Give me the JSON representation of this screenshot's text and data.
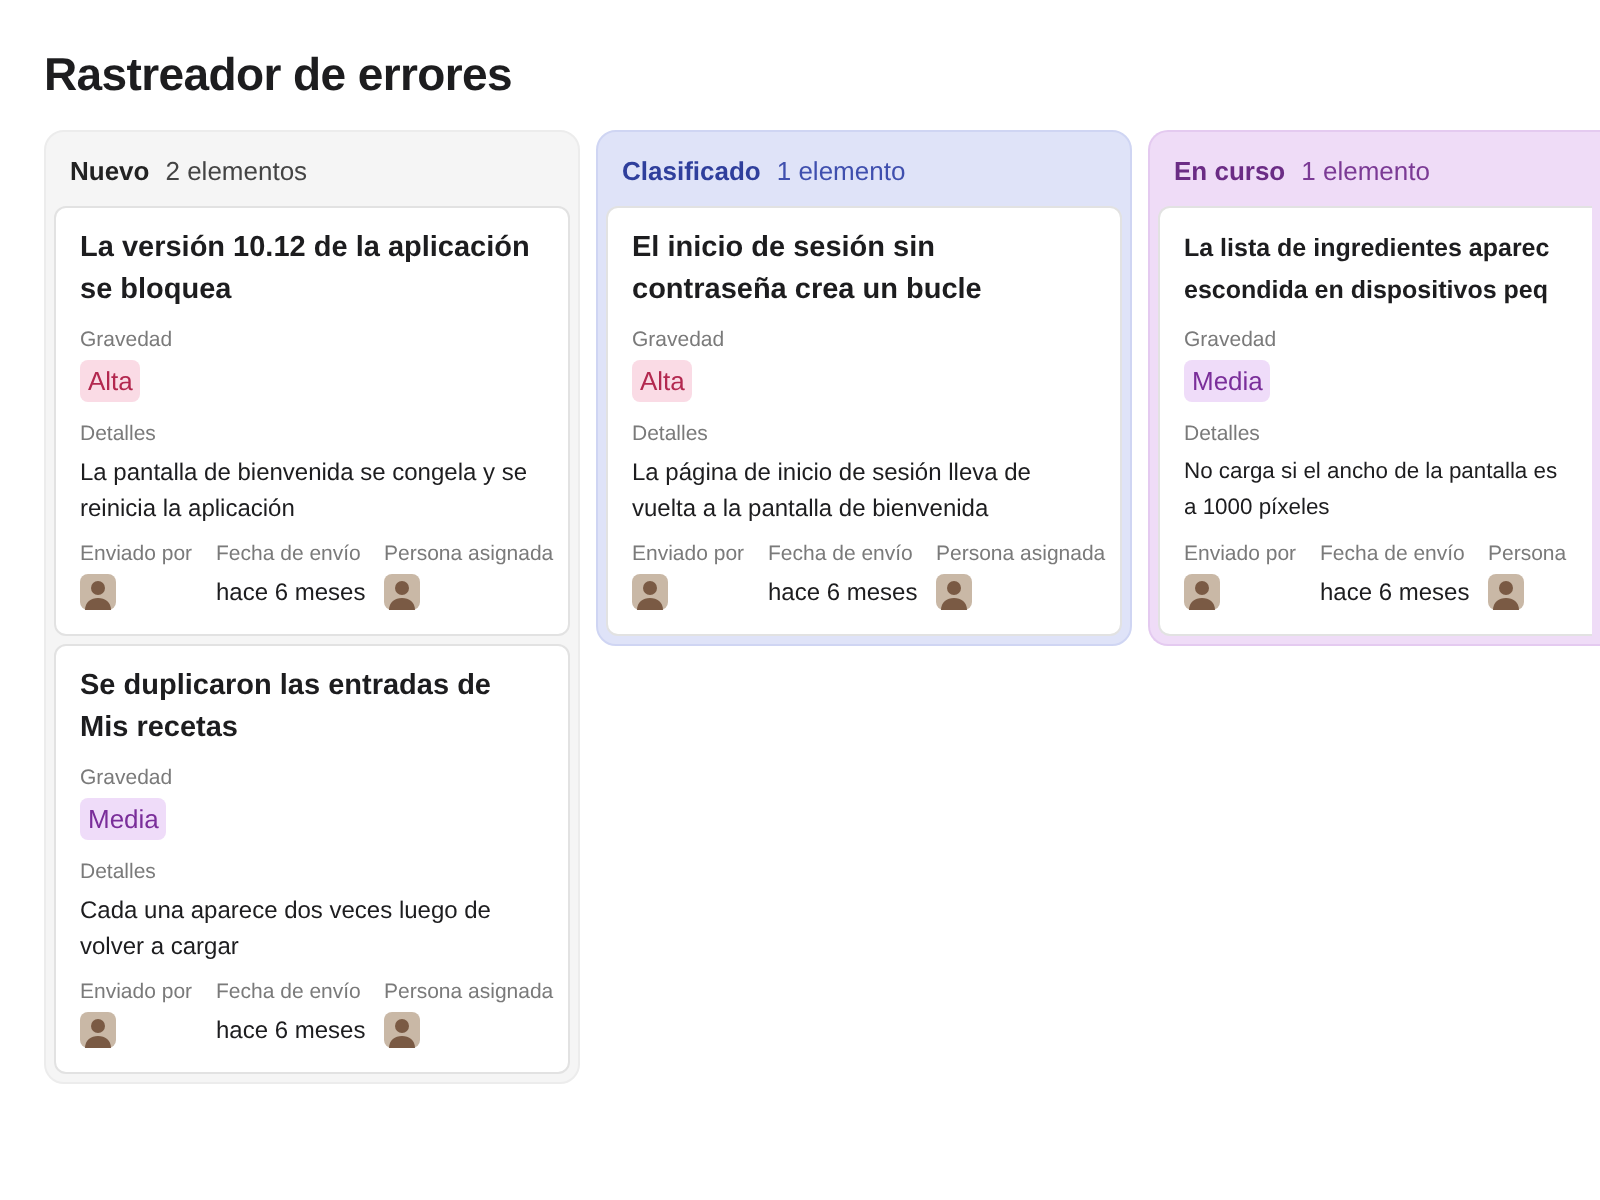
{
  "title": "Rastreador de errores",
  "columns": [
    {
      "kind": "new",
      "name": "Nuevo",
      "count": "2 elementos",
      "cards": [
        {
          "kind": "full",
          "title": "La versión 10.12 de la aplicación se bloquea",
          "severity_label": "Gravedad",
          "severity": {
            "label": "Alta",
            "kind": "high"
          },
          "details_label": "Detalles",
          "details": "La pantalla de bienvenida se congela y se reinicia la aplicación",
          "submitted_label": "Enviado por",
          "date_label": "Fecha de envío",
          "date": "hace 6 meses",
          "assignee_label": "Persona asignada"
        },
        {
          "kind": "full",
          "title": "Se duplicaron las entradas de Mis recetas",
          "severity_label": "Gravedad",
          "severity": {
            "label": "Media",
            "kind": "medium"
          },
          "details_label": "Detalles",
          "details": "Cada una aparece dos veces luego de volver a cargar",
          "submitted_label": "Enviado por",
          "date_label": "Fecha de envío",
          "date": "hace 6 meses",
          "assignee_label": "Persona asignada"
        }
      ]
    },
    {
      "kind": "triaged",
      "name": "Clasificado",
      "count": "1 elemento",
      "cards": [
        {
          "kind": "full",
          "title": "El inicio de sesión sin contraseña crea un bucle",
          "severity_label": "Gravedad",
          "severity": {
            "label": "Alta",
            "kind": "high"
          },
          "details_label": "Detalles",
          "details": "La página de inicio de sesión lleva de vuelta a la pantalla de bienvenida",
          "submitted_label": "Enviado por",
          "date_label": "Fecha de envío",
          "date": "hace 6 meses",
          "assignee_label": "Persona asignada"
        }
      ]
    },
    {
      "kind": "in_progress",
      "name": "En curso",
      "count": "1 elemento",
      "cards": [
        {
          "kind": "clipped",
          "title": "La lista de ingredientes aparec\nescondida en dispositivos peq",
          "severity_label": "Gravedad",
          "severity": {
            "label": "Media",
            "kind": "medium"
          },
          "details_label": "Detalles",
          "details": "No carga si el ancho de la pantalla es\na 1000 píxeles",
          "submitted_label": "Enviado por",
          "date_label": "Fecha de envío",
          "date": "hace 6 meses",
          "assignee_label": "Persona"
        }
      ]
    }
  ]
}
